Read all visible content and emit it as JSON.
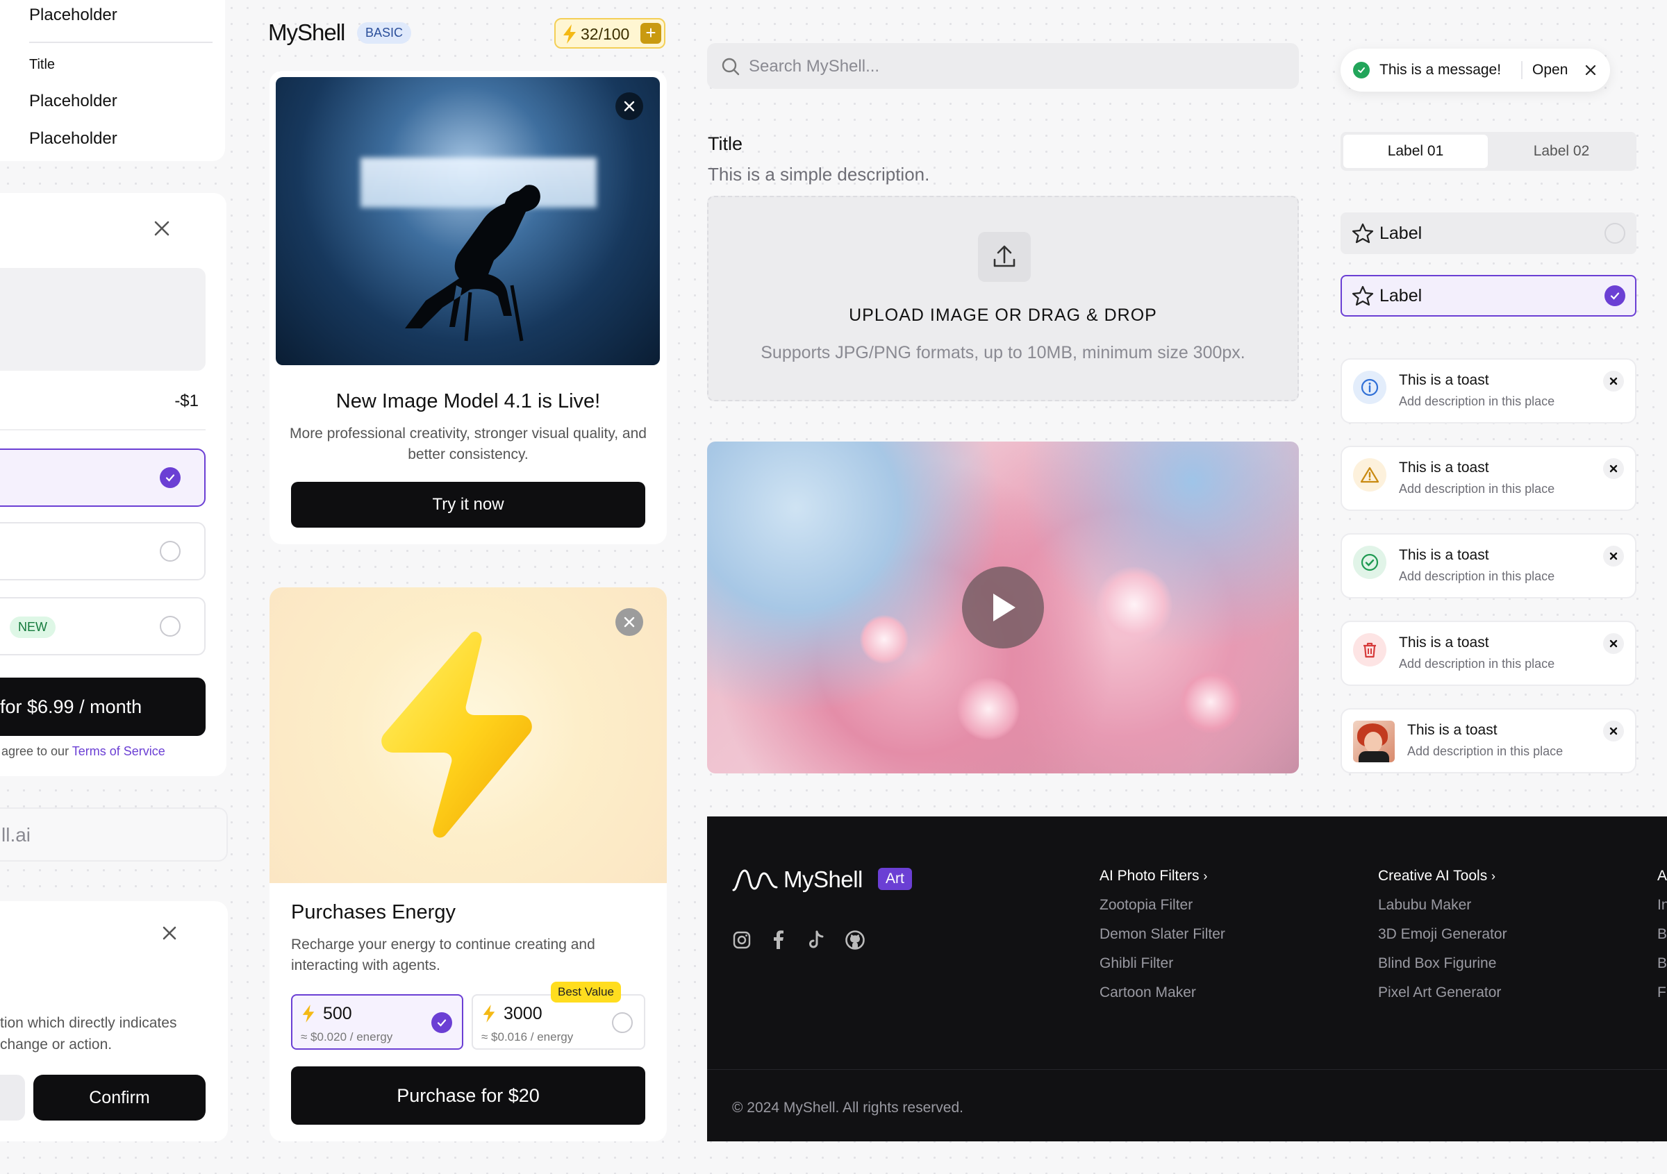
{
  "menu": {
    "items": [
      "Placeholder",
      "Title",
      "Placeholder",
      "Placeholder"
    ]
  },
  "subscribe": {
    "price_delta": "-$1",
    "new_badge": "NEW",
    "cta": "for $6.99 / month",
    "terms_prefix": "agree to our",
    "terms_link": "Terms of Service"
  },
  "email": {
    "value": "ll.ai"
  },
  "confirm_dialog": {
    "description": "tion which directly indicates change or action.",
    "confirm": "Confirm"
  },
  "brand": {
    "name": "MyShell",
    "plan": "BASIC",
    "energy": "32/100",
    "energy_plus": "+"
  },
  "announcement": {
    "title": "New Image Model 4.1 is Live!",
    "description": "More professional creativity, stronger visual quality, and better consistency.",
    "cta": "Try it now"
  },
  "purchase": {
    "title": "Purchases Energy",
    "description": "Recharge your energy to continue creating and interacting with agents.",
    "options": [
      {
        "amount": "500",
        "price": "≈ $0.020 / energy",
        "selected": true
      },
      {
        "amount": "3000",
        "price": "≈ $0.016 / energy",
        "badge": "Best Value",
        "selected": false
      }
    ],
    "cta": "Purchase for $20"
  },
  "search": {
    "placeholder": "Search MyShell..."
  },
  "upload": {
    "title": "Title",
    "description": "This is a simple description.",
    "heading": "UPLOAD IMAGE OR DRAG & DROP",
    "hint": "Supports JPG/PNG formats, up to 10MB, minimum size 300px."
  },
  "message": {
    "text": "This is a message!",
    "action": "Open"
  },
  "segmented": {
    "tabs": [
      "Label 01",
      "Label 02"
    ],
    "active": 0
  },
  "options": [
    {
      "label": "Label",
      "selected": false
    },
    {
      "label": "Label",
      "selected": true
    }
  ],
  "toasts": [
    {
      "kind": "info",
      "title": "This is a toast",
      "desc": "Add description in this place"
    },
    {
      "kind": "warning",
      "title": "This is a toast",
      "desc": "Add description in this place"
    },
    {
      "kind": "success",
      "title": "This is a toast",
      "desc": "Add description in this place"
    },
    {
      "kind": "danger",
      "title": "This is a toast",
      "desc": "Add description in this place"
    },
    {
      "kind": "avatar",
      "title": "This is a toast",
      "desc": "Add description in this place"
    }
  ],
  "footer": {
    "brand": "MyShell",
    "badge": "Art",
    "columns": [
      {
        "title": "AI Photo Filters",
        "links": [
          "Zootopia Filter",
          "Demon Slater Filter",
          "Ghibli Filter",
          "Cartoon Maker"
        ]
      },
      {
        "title": "Creative AI Tools",
        "links": [
          "Labubu Maker",
          "3D Emoji Generator",
          "Blind Box Figurine",
          "Pixel Art Generator"
        ]
      },
      {
        "title": "A",
        "links": [
          "In",
          "B",
          "B",
          "F"
        ]
      }
    ],
    "copyright": "© 2024 MyShell. All rights reserved."
  },
  "colors": {
    "accent": "#6b3fd4",
    "dark": "#0e0e10",
    "energy": "#f5c518",
    "footer_bg": "#111113"
  }
}
